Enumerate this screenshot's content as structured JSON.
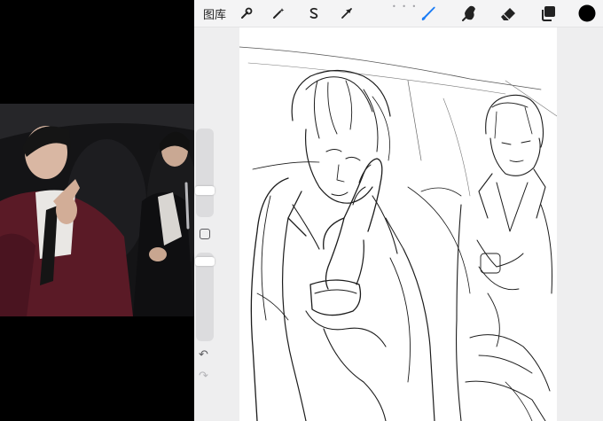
{
  "toolbar": {
    "gallery_label": "图库",
    "left_tools": [
      {
        "name": "actions",
        "icon": "wrench-icon"
      },
      {
        "name": "adjustments",
        "icon": "magic-wand-icon"
      },
      {
        "name": "selection",
        "icon": "selection-s-icon"
      },
      {
        "name": "transform",
        "icon": "arrow-cursor-icon"
      }
    ],
    "right_tools": [
      {
        "name": "brush",
        "icon": "brush-icon",
        "active": true
      },
      {
        "name": "smudge",
        "icon": "smudge-icon"
      },
      {
        "name": "eraser",
        "icon": "eraser-icon"
      },
      {
        "name": "layers",
        "icon": "layers-icon"
      },
      {
        "name": "color",
        "icon": "color-swatch",
        "color": "#000000"
      }
    ],
    "more_dots": "• • •"
  },
  "sidebar": {
    "brush_size_level": 0.72,
    "opacity_level": 0.05,
    "undo_icon": "undo-icon",
    "redo_icon": "redo-icon",
    "undo_symbol": "↶",
    "redo_symbol": "↷"
  },
  "colors": {
    "accent": "#1a7cf5",
    "toolbar_bg": "#f4f4f5",
    "canvas_bg": "#ffffff",
    "workspace_bg": "#eeeeef",
    "stroke": "#1c1c1c"
  },
  "reference_video": {
    "description_icon": "video-frame"
  }
}
